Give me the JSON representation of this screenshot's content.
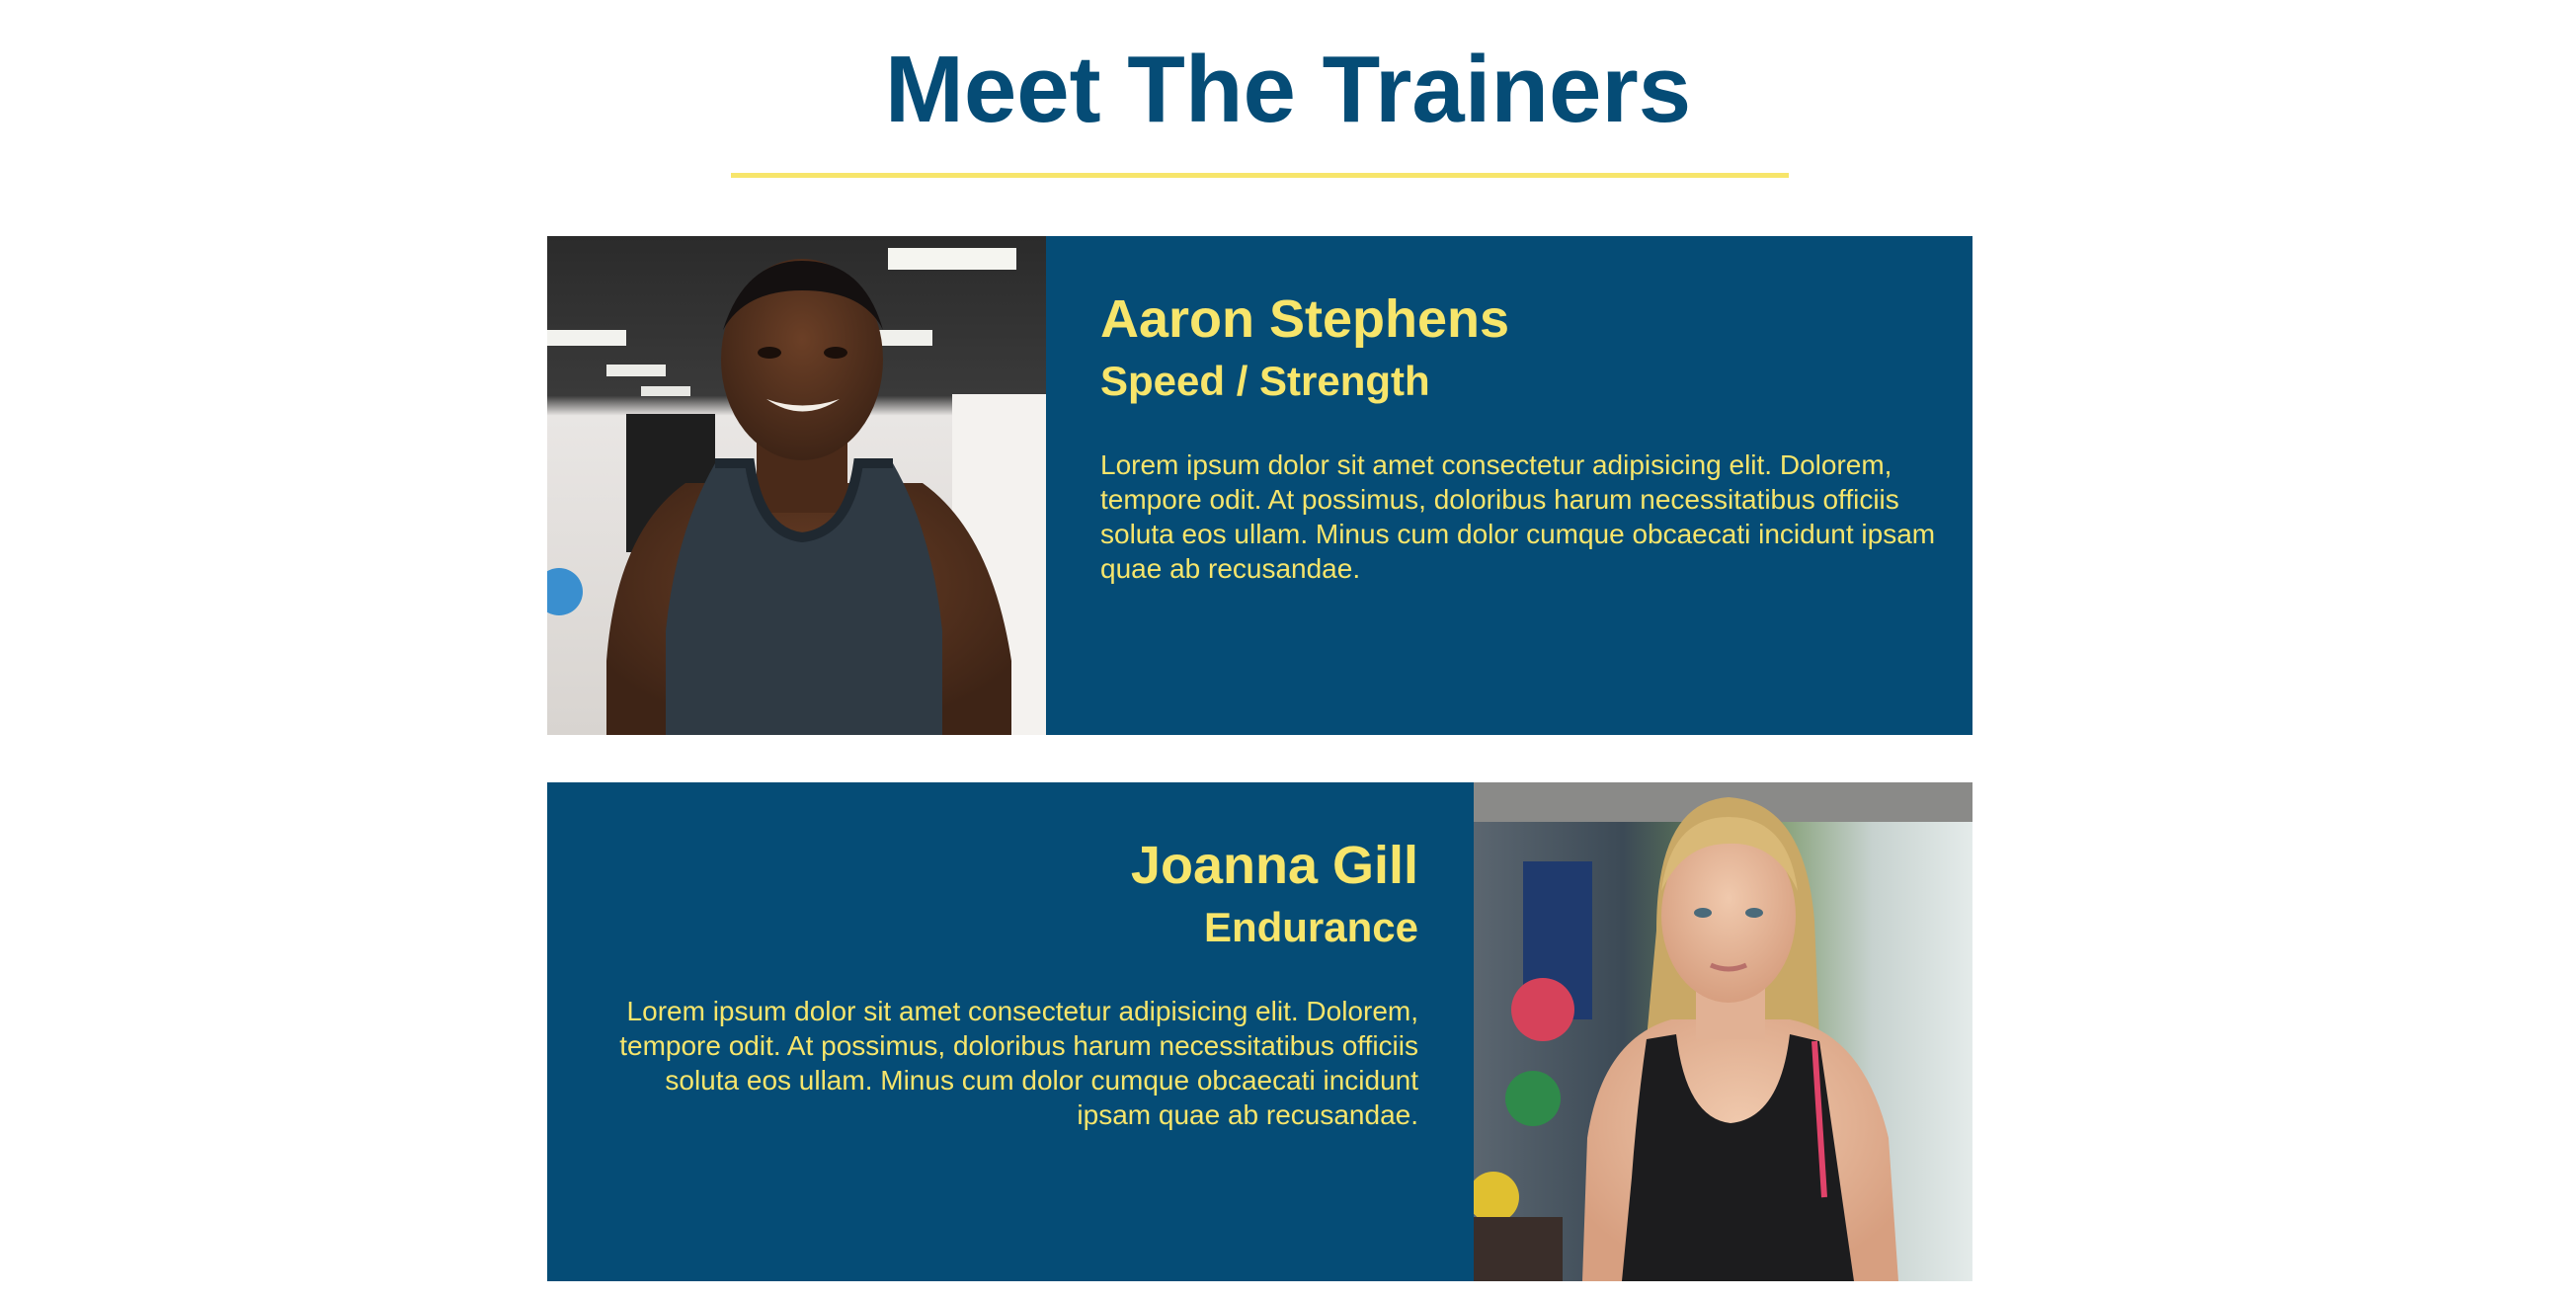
{
  "page": {
    "title": "Meet The Trainers"
  },
  "colors": {
    "primary_blue": "#054c76",
    "accent_yellow": "#f7e56b"
  },
  "trainers": [
    {
      "name": "Aaron Stephens",
      "specialty": "Speed / Strength",
      "bio": "Lorem ipsum dolor sit amet consectetur adipisicing elit. Dolorem, tempore odit. At possimus, doloribus harum necessitatibus officiis soluta eos ullam. Minus cum dolor cumque obcaecati incidunt ipsam quae ab recusandae.",
      "photo": "man-in-tank-top-gym-photo"
    },
    {
      "name": "Joanna Gill",
      "specialty": "Endurance",
      "bio": "Lorem ipsum dolor sit amet consectetur adipisicing elit. Dolorem, tempore odit. At possimus, doloribus harum necessitatibus officiis soluta eos ullam. Minus cum dolor cumque obcaecati incidunt ipsam quae ab recusandae.",
      "photo": "woman-in-tank-top-gym-photo"
    }
  ]
}
